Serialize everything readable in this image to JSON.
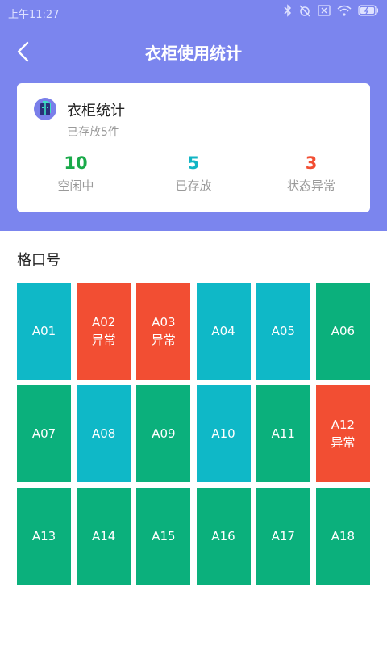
{
  "status_bar": {
    "time": "上午11:27"
  },
  "nav": {
    "title": "衣柜使用统计",
    "back_icon": "chevron-left-icon"
  },
  "card": {
    "icon": "wardrobe-icon",
    "title": "衣柜统计",
    "subtitle": "已存放5件",
    "stats": [
      {
        "value": "10",
        "label": "空闲中",
        "color": "#1aaa4a"
      },
      {
        "value": "5",
        "label": "已存放",
        "color": "#12b5c4"
      },
      {
        "value": "3",
        "label": "状态异常",
        "color": "#f24e33"
      }
    ]
  },
  "section": {
    "title": "格口号"
  },
  "colors": {
    "header": "#7b85ee",
    "idle": "#0fb8c7",
    "stored": "#0bb07c",
    "abnormal": "#f24e33"
  },
  "lockers": [
    {
      "id": "A01",
      "state": "idle",
      "note": ""
    },
    {
      "id": "A02",
      "state": "abnormal",
      "note": "异常"
    },
    {
      "id": "A03",
      "state": "abnormal",
      "note": "异常"
    },
    {
      "id": "A04",
      "state": "idle",
      "note": ""
    },
    {
      "id": "A05",
      "state": "idle",
      "note": ""
    },
    {
      "id": "A06",
      "state": "stored",
      "note": ""
    },
    {
      "id": "A07",
      "state": "stored",
      "note": ""
    },
    {
      "id": "A08",
      "state": "idle",
      "note": ""
    },
    {
      "id": "A09",
      "state": "stored",
      "note": ""
    },
    {
      "id": "A10",
      "state": "idle",
      "note": ""
    },
    {
      "id": "A11",
      "state": "stored",
      "note": ""
    },
    {
      "id": "A12",
      "state": "abnormal",
      "note": "异常"
    },
    {
      "id": "A13",
      "state": "stored",
      "note": ""
    },
    {
      "id": "A14",
      "state": "stored",
      "note": ""
    },
    {
      "id": "A15",
      "state": "stored",
      "note": ""
    },
    {
      "id": "A16",
      "state": "stored",
      "note": ""
    },
    {
      "id": "A17",
      "state": "stored",
      "note": ""
    },
    {
      "id": "A18",
      "state": "stored",
      "note": ""
    }
  ]
}
